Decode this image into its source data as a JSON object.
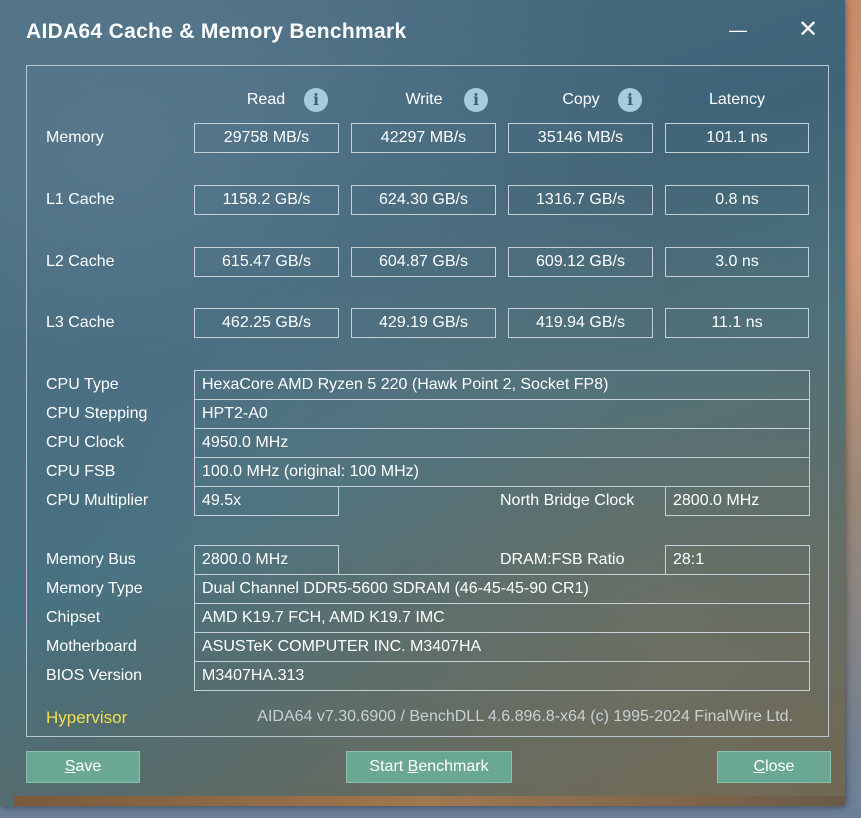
{
  "window": {
    "title": "AIDA64 Cache & Memory Benchmark",
    "minimize_icon": "minimize-icon",
    "close_icon": "close-icon"
  },
  "headers": {
    "read": "Read",
    "write": "Write",
    "copy": "Copy",
    "latency": "Latency"
  },
  "bench_rows": [
    {
      "label": "Memory",
      "read": "29758 MB/s",
      "write": "42297 MB/s",
      "copy": "35146 MB/s",
      "latency": "101.1 ns"
    },
    {
      "label": "L1 Cache",
      "read": "1158.2 GB/s",
      "write": "624.30 GB/s",
      "copy": "1316.7 GB/s",
      "latency": "0.8 ns"
    },
    {
      "label": "L2 Cache",
      "read": "615.47 GB/s",
      "write": "604.87 GB/s",
      "copy": "609.12 GB/s",
      "latency": "3.0 ns"
    },
    {
      "label": "L3 Cache",
      "read": "462.25 GB/s",
      "write": "429.19 GB/s",
      "copy": "419.94 GB/s",
      "latency": "11.1 ns"
    }
  ],
  "cpu": {
    "type_label": "CPU Type",
    "type_value": "HexaCore AMD Ryzen 5 220  (Hawk Point 2, Socket FP8)",
    "stepping_label": "CPU Stepping",
    "stepping_value": "HPT2-A0",
    "clock_label": "CPU Clock",
    "clock_value": "4950.0 MHz",
    "fsb_label": "CPU FSB",
    "fsb_value": "100.0 MHz  (original: 100 MHz)",
    "multiplier_label": "CPU Multiplier",
    "multiplier_value": "49.5x",
    "nb_clock_label": "North Bridge Clock",
    "nb_clock_value": "2800.0 MHz"
  },
  "memory": {
    "bus_label": "Memory Bus",
    "bus_value": "2800.0 MHz",
    "ratio_label": "DRAM:FSB Ratio",
    "ratio_value": "28:1",
    "type_label": "Memory Type",
    "type_value": "Dual Channel DDR5-5600 SDRAM  (46-45-45-90 CR1)",
    "chipset_label": "Chipset",
    "chipset_value": "AMD K19.7 FCH, AMD K19.7 IMC",
    "motherboard_label": "Motherboard",
    "motherboard_value": "ASUSTeK COMPUTER INC. M3407HA",
    "bios_label": "BIOS Version",
    "bios_value": "M3407HA.313"
  },
  "footer": {
    "hypervisor": "Hypervisor",
    "version": "AIDA64 v7.30.6900 / BenchDLL 4.6.896.8-x64  (c) 1995-2024 FinalWire Ltd."
  },
  "buttons": {
    "save_first": "S",
    "save_rest": "ave",
    "start_pre": "Start ",
    "start_ul": "B",
    "start_rest": "enchmark",
    "close_first": "C",
    "close_rest": "lose"
  },
  "colors": {
    "hypervisor": "#f0e04a",
    "button_bg": "#6aa894",
    "info_icon": "#a8ccdc"
  }
}
